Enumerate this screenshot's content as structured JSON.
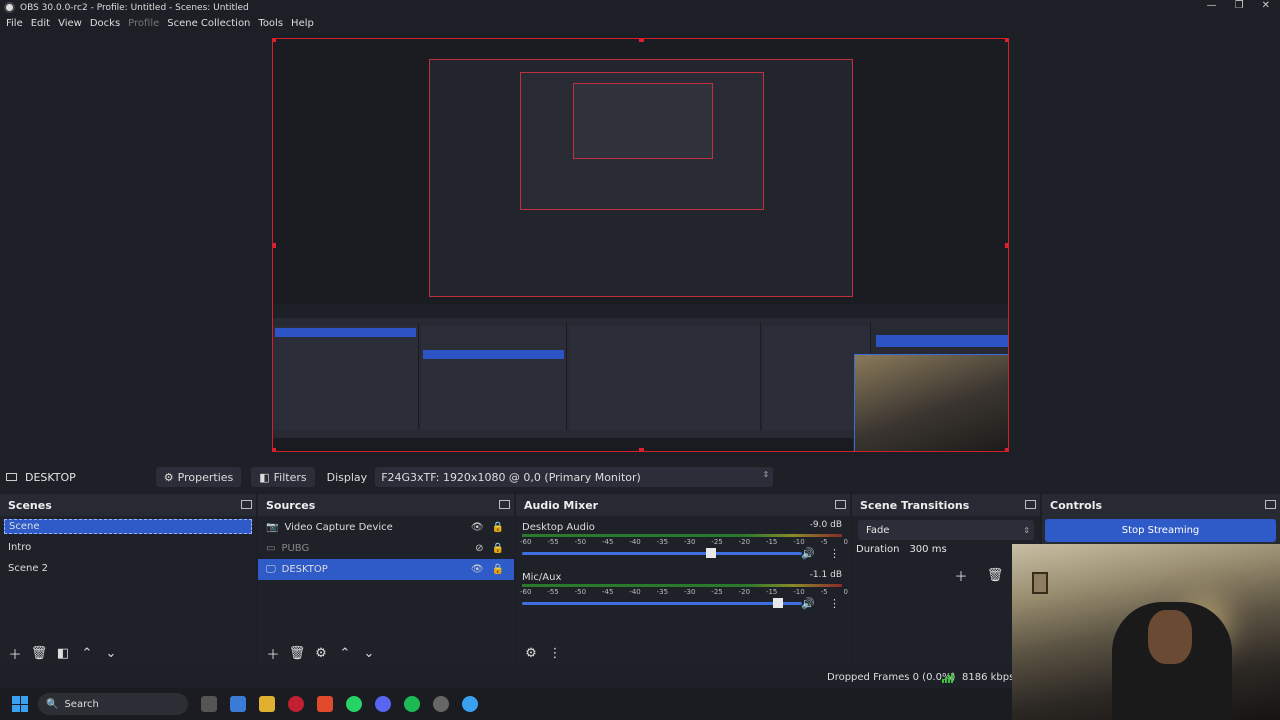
{
  "window": {
    "title": "OBS 30.0.0-rc2 - Profile: Untitled - Scenes: Untitled"
  },
  "menu": [
    "File",
    "Edit",
    "View",
    "Docks",
    "Profile",
    "Scene Collection",
    "Tools",
    "Help"
  ],
  "source_bar": {
    "source_name": "DESKTOP",
    "properties_label": "Properties",
    "filters_label": "Filters",
    "display_label": "Display",
    "display_value": "F24G3xTF: 1920x1080 @ 0,0 (Primary Monitor)"
  },
  "scenes": {
    "title": "Scenes",
    "items": [
      "Scene",
      "Intro",
      "Scene 2"
    ]
  },
  "sources": {
    "title": "Sources",
    "items": [
      "Video Capture Device",
      "PUBG",
      "DESKTOP"
    ]
  },
  "mixer": {
    "title": "Audio Mixer",
    "channels": [
      {
        "name": "Desktop Audio",
        "db": "-9.0 dB",
        "level": 0.68
      },
      {
        "name": "Mic/Aux",
        "db": "-1.1 dB",
        "level": 0.93
      }
    ],
    "ticks": [
      "-60",
      "-55",
      "-50",
      "-45",
      "-40",
      "-35",
      "-30",
      "-25",
      "-20",
      "-15",
      "-10",
      "-5",
      "0"
    ]
  },
  "transitions": {
    "title": "Scene Transitions",
    "type": "Fade",
    "duration_label": "Duration",
    "duration_value": "300 ms"
  },
  "controls": {
    "title": "Controls",
    "stop_streaming": "Stop Streaming"
  },
  "status": {
    "dropped_frames": "Dropped Frames 0 (0.0%)",
    "kbps": "8186 kbps"
  },
  "taskbar": {
    "search": "Search"
  },
  "colors": {
    "accent": "#2f5bc9",
    "preview_border": "#d0202a"
  }
}
